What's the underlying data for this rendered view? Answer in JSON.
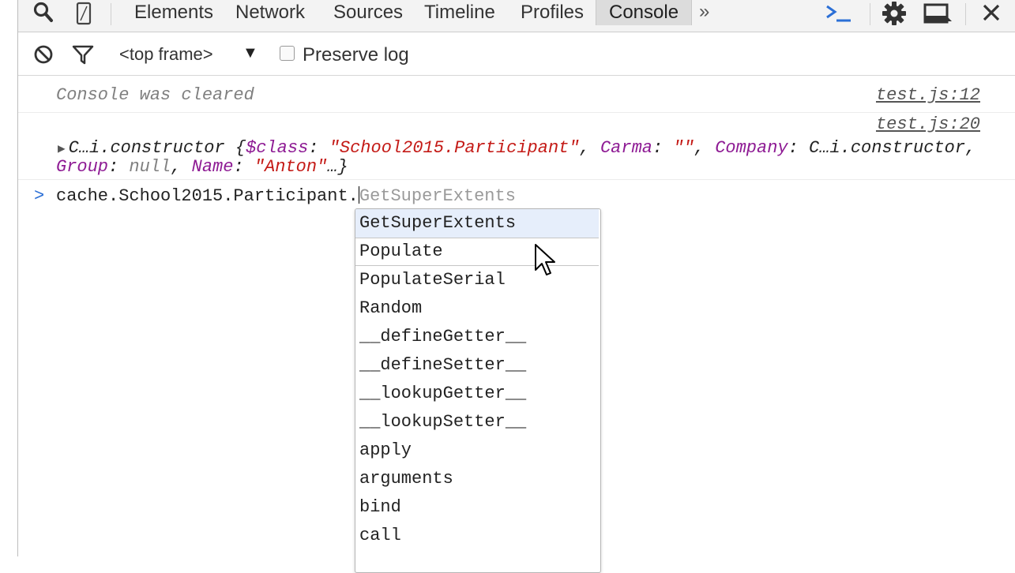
{
  "devtools": {
    "tabs": [
      "Elements",
      "Network",
      "Sources",
      "Timeline",
      "Profiles",
      "Console"
    ],
    "active_tab": "Console",
    "more_label": "»"
  },
  "toolbar": {
    "frame_selector": "<top frame>",
    "frame_arrow": "▼",
    "preserve_log_label": "Preserve log",
    "preserve_log_checked": false
  },
  "console": {
    "messages": [
      {
        "text": "Console was cleared",
        "source": "test.js:12"
      },
      {
        "source": "test.js:20",
        "object_prefix": "C…i.constructor {",
        "fields": [
          {
            "key": "$class",
            "value": "\"School2015.Participant\""
          },
          {
            "key": "Carma",
            "value": "\"\""
          },
          {
            "key": "Company",
            "value": "C…i.constructor"
          },
          {
            "key": "Group",
            "value": "null"
          },
          {
            "key": "Name",
            "value": "\"Anton\""
          }
        ],
        "object_suffix": "…}"
      }
    ],
    "prompt": {
      "caret": ">",
      "typed": "cache.School2015.Participant.",
      "ghost_completion": "GetSuperExtents"
    },
    "autocomplete": {
      "selected_index": 0,
      "hover_index": 1,
      "items": [
        "GetSuperExtents",
        "Populate",
        "PopulateSerial",
        "Random",
        "__defineGetter__",
        "__defineSetter__",
        "__lookupGetter__",
        "__lookupSetter__",
        "apply",
        "arguments",
        "bind",
        "call"
      ]
    }
  },
  "colors": {
    "accent": "#2b6fd6",
    "key": "#8e1b94",
    "string": "#c41a16"
  }
}
